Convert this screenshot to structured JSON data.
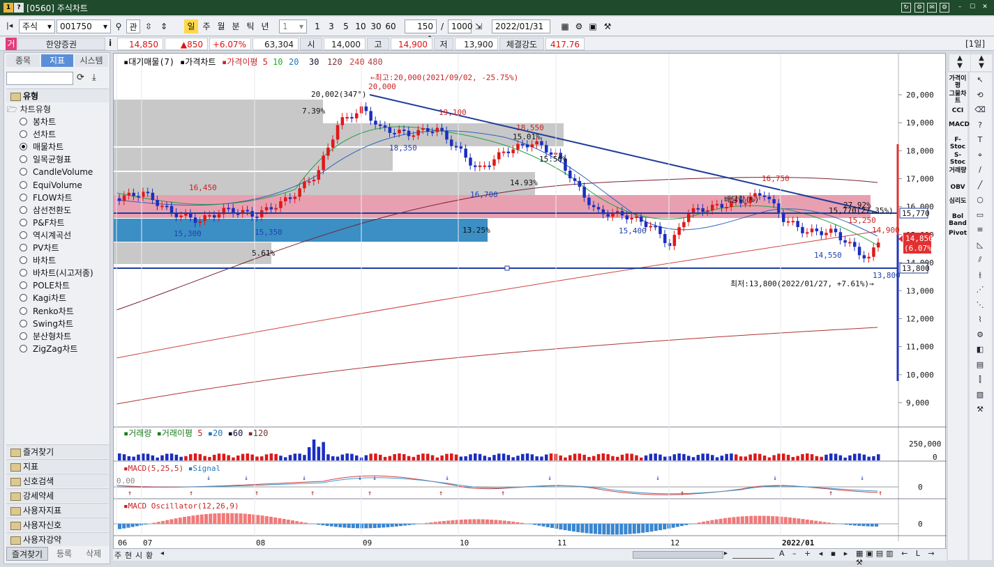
{
  "window": {
    "title": "[0560] 주식차트",
    "badges": [
      "1",
      "?"
    ],
    "controls": [
      "↻",
      "⚙",
      "✉",
      "⚙",
      "–",
      "☐",
      "✕"
    ]
  },
  "toolbar": {
    "market": "주식",
    "code": "001750",
    "btn_gwan": "관",
    "periods": [
      "일",
      "주",
      "월",
      "분",
      "틱",
      "년"
    ],
    "period_selected": "일",
    "unit": "1",
    "quick": [
      "1",
      "3",
      "5",
      "10",
      "30",
      "60"
    ],
    "count": "150",
    "slash": "/",
    "total": "1000",
    "date": "2022/01/31"
  },
  "quote": {
    "badge": "거",
    "name": "한양증권",
    "i": "i",
    "price": "14,850",
    "change": "▲850",
    "pct": "+6.07%",
    "volume": "63,304",
    "open_label": "시",
    "open": "14,000",
    "high_label": "고",
    "high": "14,900",
    "low_label": "저",
    "low": "13,900",
    "strength_label": "체결강도",
    "strength": "417.76",
    "day": "[1일]"
  },
  "left": {
    "tabs": [
      "종목",
      "지표",
      "시스템"
    ],
    "tab_selected": "지표",
    "section": "유형",
    "group": "차트유형",
    "items": [
      "봉차트",
      "선차트",
      "매물차트",
      "일목균형표",
      "CandleVolume",
      "EquiVolume",
      "FLOW차트",
      "삼선전환도",
      "P&F차트",
      "역시계곡선",
      "PV차트",
      "바차트",
      "바차트(시고저종)",
      "POLE차트",
      "Kagi차트",
      "Renko차트",
      "Swing차트",
      "분산형차트",
      "ZigZag차트"
    ],
    "selected": "매물차트",
    "sections": [
      "즐겨찾기",
      "지표",
      "신호검색",
      "강세약세",
      "사용자지표",
      "사용자신호",
      "사용자강약"
    ],
    "bottom": [
      "즐겨찾기",
      "등록",
      "삭제"
    ]
  },
  "chart": {
    "legend_main": [
      "대기매물(7)",
      "가격차트",
      "가격이평",
      "5",
      "10",
      "20",
      "30",
      "120",
      "240",
      "480"
    ],
    "y_ticks": [
      "20,000",
      "19,000",
      "18,000",
      "17,000",
      "16,000",
      "15,000",
      "14,000",
      "13,000",
      "12,000",
      "11,000",
      "10,000",
      "9,000"
    ],
    "x_ticks": [
      "06",
      "07",
      "08",
      "09",
      "10",
      "11",
      "12",
      "2022/01"
    ],
    "annotations": {
      "high": "←최고:20,000(2021/09/02, -25.75%)",
      "high2": "20,000",
      "high3": "20,002(347°)",
      "low": "최저:13,800(2022/01/27, +7.61%)→",
      "low2": "13,800",
      "p19100": "19,100",
      "p18550": "18,550",
      "p18350": "18,350",
      "p16750": "16,750",
      "p16700": "16,700",
      "p16450": "16,450",
      "p15400": "15,400",
      "p15350": "15,350",
      "p15300": "15,300",
      "p15250": "15,250",
      "p14900": "14,900",
      "p14550": "14,550",
      "p15770": "15,770(27.35%)",
      "pct15": "15.01%",
      "pct1556": "15.56%",
      "pct1493": "14.93%",
      "pct2792": "27.92%",
      "pct739": "7.39%",
      "pct1325": "13.25%",
      "pct561": "5.61%",
      "pct8": "배당락(%)"
    },
    "cur_price": "14,850",
    "cur_pct": "(6.07%)",
    "box_15770": "15,770",
    "box_13800": "13,800",
    "volume_legend": [
      "거래량",
      "거래이평",
      "5",
      "20",
      "60",
      "120"
    ],
    "vol_ticks": [
      "250,000",
      "0"
    ],
    "macd_legend": [
      "MACD(5,25,5)",
      "Signal"
    ],
    "macd_zero": "0",
    "macd_val": "0.00",
    "osc_legend": "MACD Oscillator(12,26,9)",
    "osc_zero": "0"
  },
  "sidebar": [
    "가격이평",
    "그물차트",
    "CCI",
    "MACD",
    "F-Stoc",
    "S-Stoc",
    "거래량",
    "OBV",
    "심리도",
    "Bol Band",
    "Pivot"
  ],
  "bottom": {
    "tabs": [
      "주",
      "현",
      "시",
      "황"
    ]
  },
  "chart_data": {
    "type": "bar",
    "title": "",
    "categories": [
      "06",
      "07",
      "08",
      "09",
      "10",
      "11",
      "12",
      "2022/01"
    ],
    "series": [
      {
        "name": "",
        "values": [
          16300,
          16500,
          15700,
          19500,
          17300,
          16900,
          15600,
          14850
        ]
      }
    ],
    "ylim": [
      9000,
      20000
    ],
    "volume_profile": [
      7.39,
      14.93,
      13.25,
      5.61,
      27.92
    ],
    "price_high": 20000,
    "price_low": 13800
  }
}
